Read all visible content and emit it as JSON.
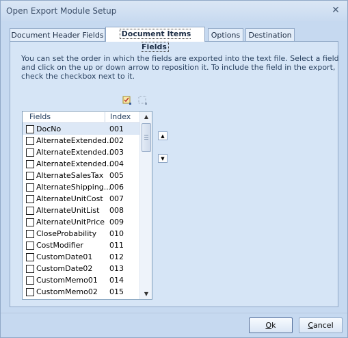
{
  "window": {
    "title": "Open Export Module Setup",
    "close_glyph": "✕"
  },
  "tabs": [
    {
      "label": "Document Header Fields",
      "active": false
    },
    {
      "label": "Document Items Fields",
      "active": true
    },
    {
      "label": "Options",
      "active": false
    },
    {
      "label": "Destination",
      "active": false
    }
  ],
  "panel": {
    "description": "You can set the order in which the fields are exported into the text file.  Select a field and click on the up or down arrow to reposition it.  To include the field in the export, check the checkbox next to it.",
    "toolbar": {
      "check_all_icon": "check-all-icon",
      "uncheck_all_icon": "uncheck-all-icon"
    },
    "list": {
      "headers": {
        "fields": "Fields",
        "index": "Index"
      },
      "rows": [
        {
          "field": "DocNo",
          "index": "001",
          "checked": false,
          "selected": true
        },
        {
          "field": "AlternateExtended...",
          "index": "002",
          "checked": false
        },
        {
          "field": "AlternateExtended...",
          "index": "003",
          "checked": false
        },
        {
          "field": "AlternateExtended...",
          "index": "004",
          "checked": false
        },
        {
          "field": "AlternateSalesTax",
          "index": "005",
          "checked": false
        },
        {
          "field": "AlternateShipping...",
          "index": "006",
          "checked": false
        },
        {
          "field": "AlternateUnitCost",
          "index": "007",
          "checked": false
        },
        {
          "field": "AlternateUnitList",
          "index": "008",
          "checked": false
        },
        {
          "field": "AlternateUnitPrice",
          "index": "009",
          "checked": false
        },
        {
          "field": "CloseProbability",
          "index": "010",
          "checked": false
        },
        {
          "field": "CostModifier",
          "index": "011",
          "checked": false
        },
        {
          "field": "CustomDate01",
          "index": "012",
          "checked": false
        },
        {
          "field": "CustomDate02",
          "index": "013",
          "checked": false
        },
        {
          "field": "CustomMemo01",
          "index": "014",
          "checked": false
        },
        {
          "field": "CustomMemo02",
          "index": "015",
          "checked": false
        }
      ]
    },
    "move_up_glyph": "▲",
    "move_down_glyph": "▼",
    "scroll_up_glyph": "▲",
    "scroll_down_glyph": "▼"
  },
  "buttons": {
    "ok_label_mnemonic": "O",
    "ok_label_rest": "k",
    "cancel_label_mnemonic": "C",
    "cancel_label_rest": "ancel"
  }
}
